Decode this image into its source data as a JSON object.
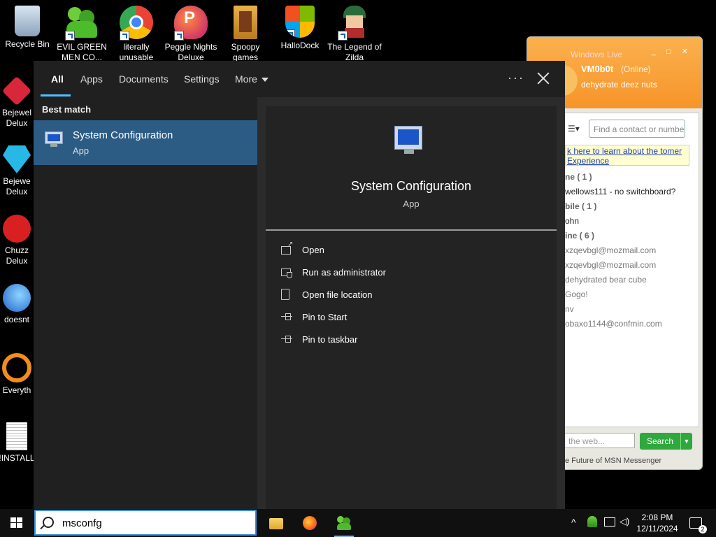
{
  "desktop": {
    "icons": [
      {
        "label": "Recycle Bin",
        "icon": "recycle-bin-icon"
      },
      {
        "label": "EVIL GREEN MEN CO...",
        "icon": "msn-people-icon"
      },
      {
        "label": "literally unusable",
        "icon": "chrome-icon"
      },
      {
        "label": "Peggle Nights Deluxe",
        "icon": "peggle-icon"
      },
      {
        "label": "Spoopy games",
        "icon": "folder-icon"
      },
      {
        "label": "HalloDock",
        "icon": "windows-shield-icon"
      },
      {
        "label": "The Legend of Zilda",
        "icon": "zilda-icon"
      }
    ],
    "left_icons": [
      {
        "label": "Bejewel Delux",
        "icon": "bejeweled-icon"
      },
      {
        "label": "Bejewe Delux",
        "icon": "diamond-icon"
      },
      {
        "label": "Chuzz Delux",
        "icon": "chuzzle-icon"
      },
      {
        "label": "doesnt",
        "icon": "thunderbird-icon"
      },
      {
        "label": "Everyth",
        "icon": "magnifier-icon"
      },
      {
        "label": "!INSTALL",
        "icon": "text-file-icon"
      }
    ]
  },
  "msn": {
    "title": "Windows Live",
    "user": "VM0b0t",
    "status": "(Online)",
    "personal_message": "dehydrate deez nuts",
    "find_placeholder": "Find a contact or numbe",
    "ad_text": "k here to learn about the tomer Experience",
    "contacts": [
      {
        "text": "ne ( 1 )",
        "type": "grp"
      },
      {
        "text": "wellows111 - no switchboard?",
        "type": "item"
      },
      {
        "text": "bile ( 1 )",
        "type": "grp"
      },
      {
        "text": "ohn",
        "type": "item"
      },
      {
        "text": "ine ( 6 )",
        "type": "grp"
      },
      {
        "text": "xzqevbgl@mozmail.com",
        "type": "dim"
      },
      {
        "text": "xzqevbgl@mozmail.com",
        "type": "dim"
      },
      {
        "text": "dehydrated bear cube",
        "type": "dim"
      },
      {
        "text": "Gogo!",
        "type": "dim"
      },
      {
        "text": "nv",
        "type": "dim"
      },
      {
        "text": "obaxo1144@confmin.com",
        "type": "dim"
      }
    ],
    "search_placeholder": "the web...",
    "search_button": "Search",
    "footer": "e Future of MSN Messenger"
  },
  "search_panel": {
    "tabs": [
      {
        "label": "All",
        "active": true
      },
      {
        "label": "Apps",
        "active": false
      },
      {
        "label": "Documents",
        "active": false
      },
      {
        "label": "Settings",
        "active": false
      },
      {
        "label": "More",
        "active": false
      }
    ],
    "more_dots": "···",
    "best_match_label": "Best match",
    "best_match": {
      "title": "System Configuration",
      "subtitle": "App"
    },
    "detail": {
      "title": "System Configuration",
      "subtitle": "App",
      "actions": [
        {
          "label": "Open",
          "icon": "open-window-icon"
        },
        {
          "label": "Run as administrator",
          "icon": "admin-shield-icon"
        },
        {
          "label": "Open file location",
          "icon": "file-location-icon"
        },
        {
          "label": "Pin to Start",
          "icon": "pin-icon"
        },
        {
          "label": "Pin to taskbar",
          "icon": "pin-icon"
        }
      ]
    }
  },
  "taskbar": {
    "search_query": "msconfg",
    "apps": [
      "file-explorer-icon",
      "firefox-icon",
      "msn-messenger-icon"
    ],
    "time": "2:08 PM",
    "date": "12/11/2024",
    "notification_count": "2"
  }
}
